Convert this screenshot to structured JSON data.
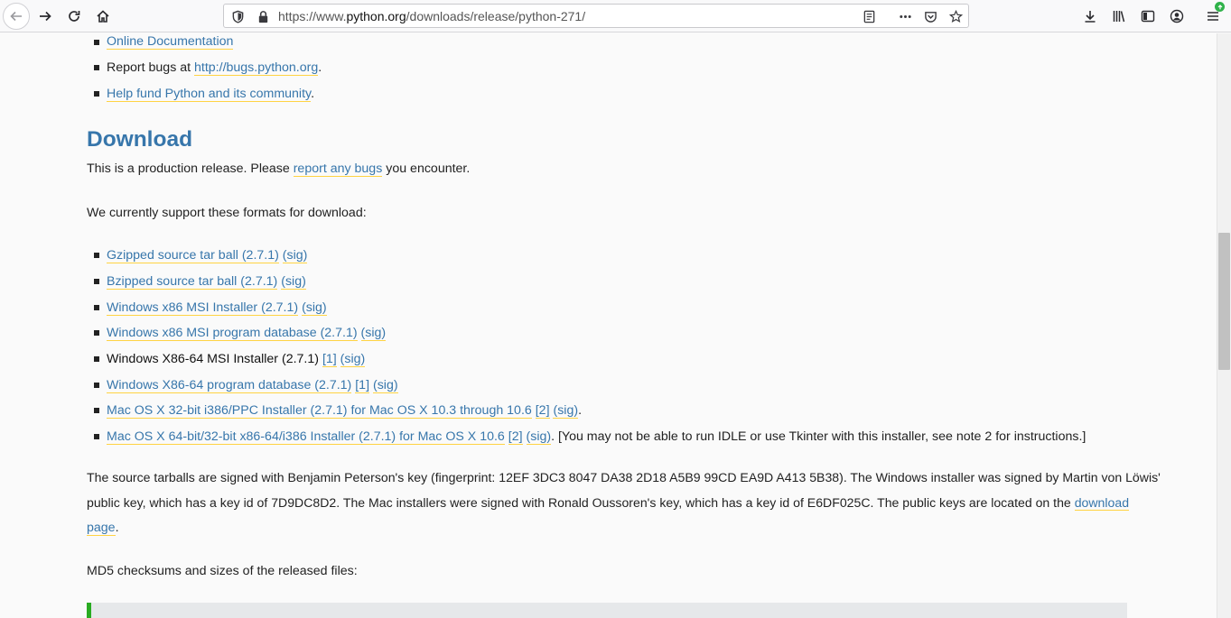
{
  "browser": {
    "url_prefix": "https://www.",
    "url_host": "python.org",
    "url_path": "/downloads/release/python-271/",
    "icons": [
      "back-icon",
      "forward-icon",
      "reload-icon",
      "home-icon",
      "shield-icon",
      "lock-icon",
      "reader-view-icon",
      "more-icon",
      "pocket-icon",
      "star-icon",
      "download-icon",
      "library-icon",
      "sidebar-icon",
      "account-icon",
      "menu-icon"
    ]
  },
  "top_list": [
    {
      "link": "Online Documentation",
      "prefix": "",
      "suffix": ""
    },
    {
      "prefix": "Report bugs at ",
      "link": "http://bugs.python.org",
      "suffix": "."
    },
    {
      "prefix": "",
      "link": "Help fund Python and its community",
      "suffix": "."
    }
  ],
  "download": {
    "heading": "Download",
    "intro_prefix": "This is a production release. Please ",
    "intro_link": "report any bugs",
    "intro_suffix": " you encounter.",
    "formats_intro": "We currently support these formats for download:",
    "items": [
      {
        "main": "Gzipped source tar ball (2.7.1)",
        "sig": "(sig)"
      },
      {
        "main": "Bzipped source tar ball (2.7.1)",
        "sig": "(sig)"
      },
      {
        "main": "Windows x86 MSI Installer (2.7.1)",
        "sig": "(sig)"
      },
      {
        "main": "Windows x86 MSI program database (2.7.1)",
        "sig": "(sig)"
      },
      {
        "main_plain": "Windows X86-64 MSI Installer (2.7.1)",
        "note": "[1]",
        "sig": "(sig)"
      },
      {
        "main": "Windows X86-64 program database (2.7.1)",
        "note": "[1]",
        "sig": "(sig)"
      },
      {
        "main": "Mac OS X 32-bit i386/PPC Installer (2.7.1) for Mac OS X 10.3 through 10.6",
        "note": "[2]",
        "sig": "(sig)",
        "suffix": "."
      },
      {
        "main": "Mac OS X 64-bit/32-bit x86-64/i386 Installer (2.7.1) for Mac OS X 10.6",
        "note": "[2]",
        "sig": "(sig)",
        "suffix": ". [You may not be able to run IDLE or use Tkinter with this installer, see note 2 for instructions.]"
      }
    ],
    "signing_line1": "The source tarballs are signed with Benjamin Peterson's key (fingerprint: 12EF 3DC3 8047 DA38 2D18 A5B9 99CD EA9D A413 5B38). The Windows installer was signed by Martin von Löwis'",
    "signing_line2": "public key, which has a key id of 7D9DC8D2. The Mac installers were signed with Ronald Oussoren's key, which has a key id of E6DF025C. The public keys are located on the ",
    "signing_link_a": "download",
    "signing_link_b": "page",
    "signing_end": ".",
    "md5_intro": "MD5 checksums and sizes of the released files:"
  }
}
